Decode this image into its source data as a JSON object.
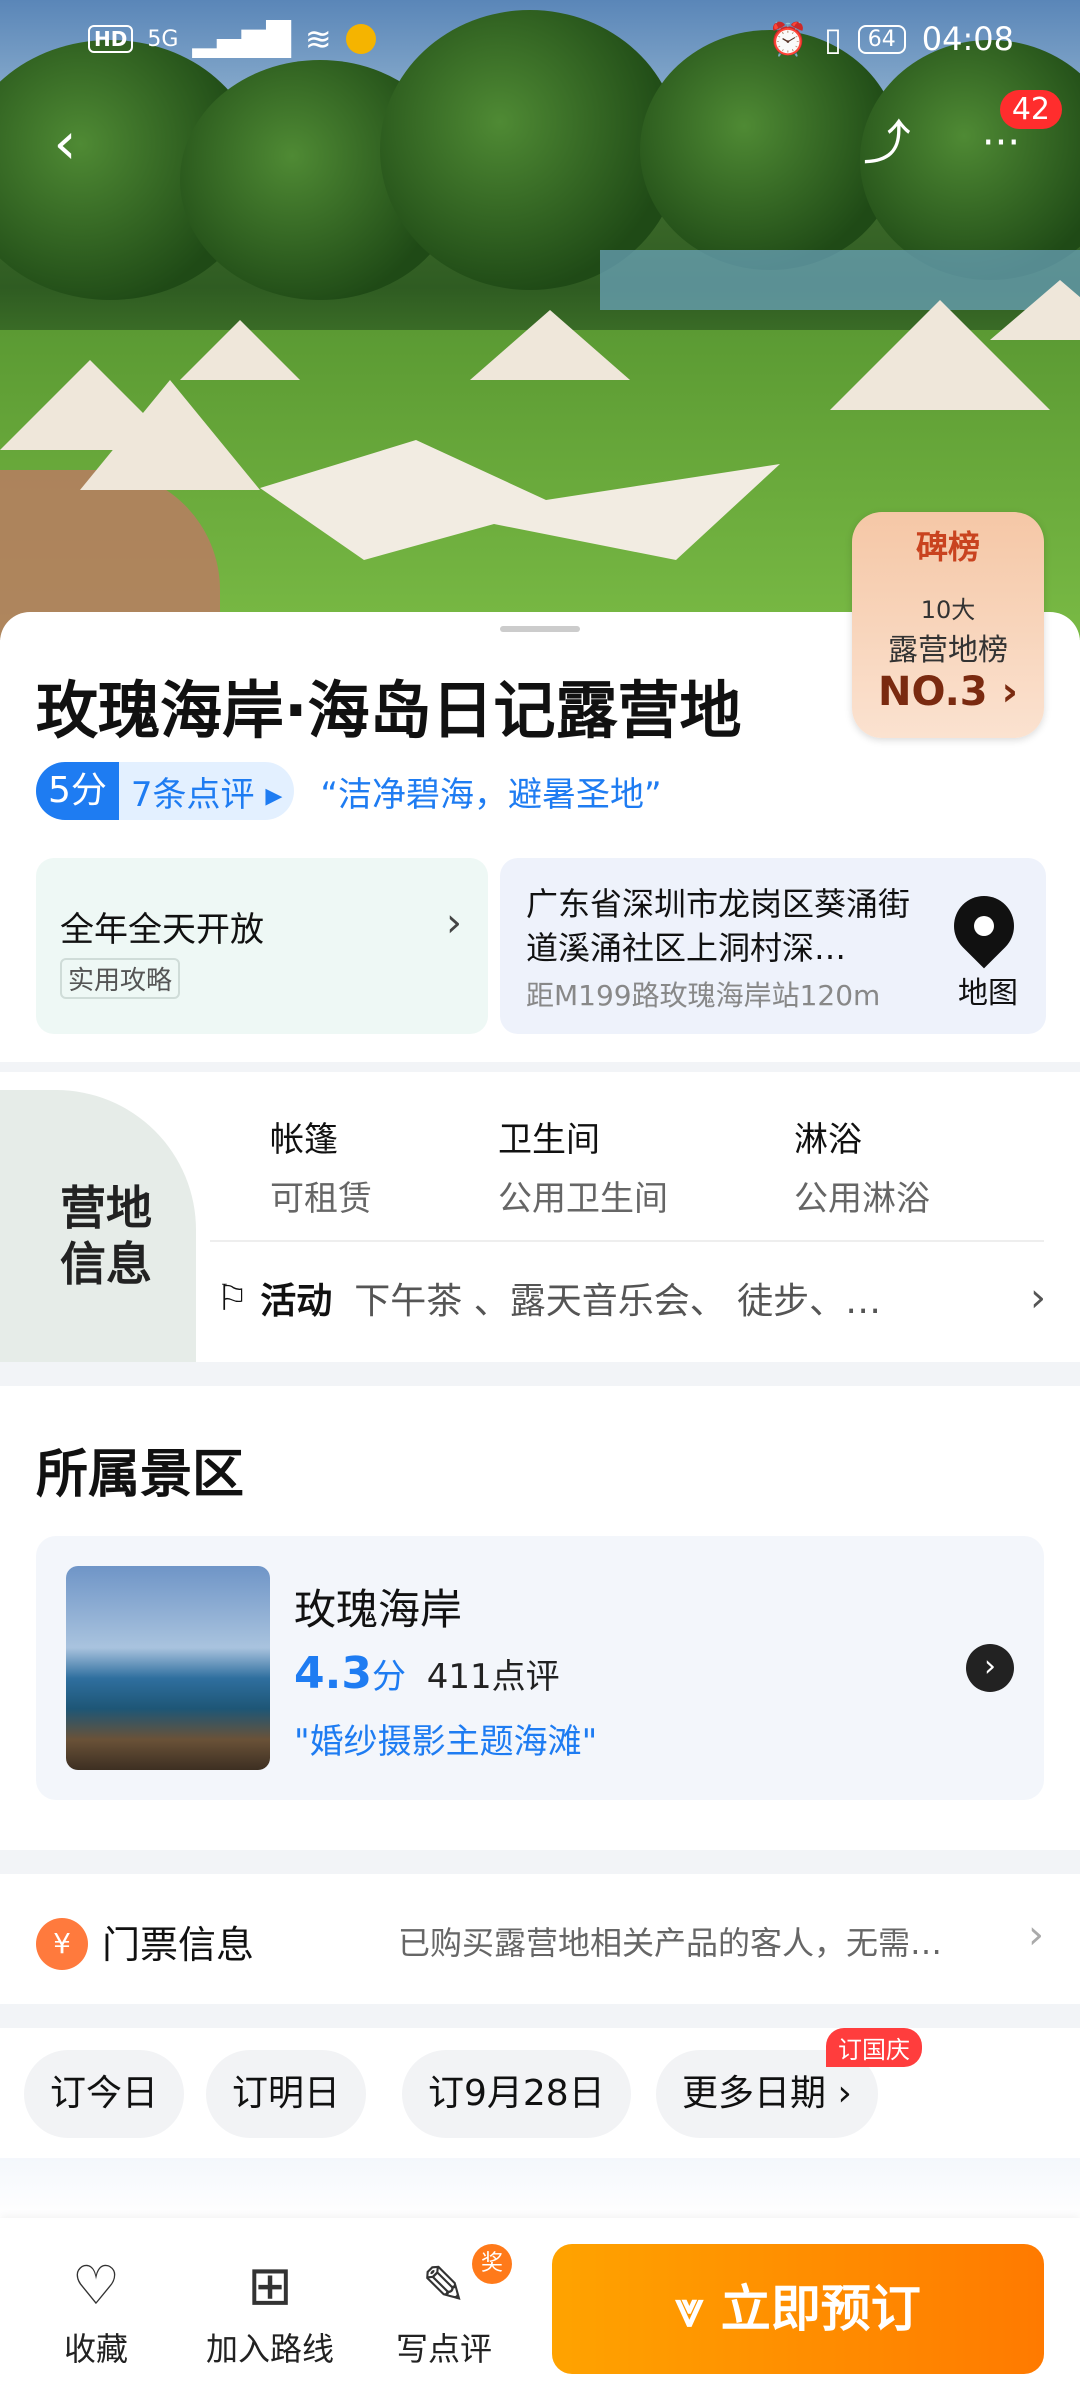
{
  "status_bar": {
    "time": "04:08",
    "battery": "64",
    "hd": "HD",
    "network": "5G"
  },
  "header": {
    "back": "‹",
    "share": "⤴",
    "more": "···",
    "notification_count": "42"
  },
  "rank": {
    "brand": "碑榜",
    "top": "10大",
    "list": "露营地榜",
    "position": "NO.3 ›"
  },
  "poi": {
    "title": "玫瑰海岸·海岛日记露营地",
    "score": "5分",
    "reviews": "7条点评 ▸",
    "tagline": "“洁净碧海，避暑圣地”",
    "hours": "全年全天开放",
    "guide_tag": "实用攻略",
    "address": "广东省深圳市龙岗区葵涌街道溪涌社区上洞村深…",
    "distance": "距M199路玫瑰海岸站120m",
    "map_label": "地图"
  },
  "camp_info": {
    "label": "营地信息",
    "facilities": [
      {
        "name": "帐篷",
        "value": "可租赁"
      },
      {
        "name": "卫生间",
        "value": "公用卫生间"
      },
      {
        "name": "淋浴",
        "value": "公用淋浴"
      }
    ],
    "activity_label": "活动",
    "activity_value": "下午茶 、露天音乐会、 徒步、…"
  },
  "scenic": {
    "heading": "所属景区",
    "name": "玫瑰海岸",
    "score": "4.3",
    "score_unit": "分",
    "reviews": "411点评",
    "quote": "\"婚纱摄影主题海滩\""
  },
  "ticket": {
    "label": "门票信息",
    "value": "已购买露营地相关产品的客人，无需…"
  },
  "dates": {
    "chips": [
      "订今日",
      "订明日",
      "订9月28日",
      "更多日期 ›"
    ],
    "badge": "订国庆"
  },
  "bottom_bar": {
    "favorite": "收藏",
    "add_route": "加入路线",
    "write_review": "写点评",
    "reward_badge": "奖",
    "book_now": "⩔ 立即预订"
  },
  "colors": {
    "accent": "#1e7cf2",
    "book": "#ff8a00",
    "badge": "#ff2d2d"
  }
}
